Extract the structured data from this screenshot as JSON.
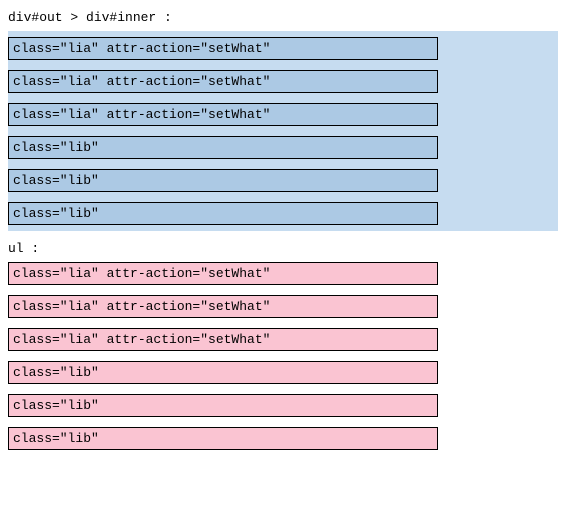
{
  "section1": {
    "label": "div#out > div#inner :",
    "rows": [
      "class=\"lia\" attr-action=\"setWhat\"",
      "class=\"lia\" attr-action=\"setWhat\"",
      "class=\"lia\" attr-action=\"setWhat\"",
      "class=\"lib\"",
      "class=\"lib\"",
      "class=\"lib\""
    ]
  },
  "section2": {
    "label": "ul :",
    "rows": [
      "class=\"lia\" attr-action=\"setWhat\"",
      "class=\"lia\" attr-action=\"setWhat\"",
      "class=\"lia\" attr-action=\"setWhat\"",
      "class=\"lib\"",
      "class=\"lib\"",
      "class=\"lib\""
    ]
  }
}
